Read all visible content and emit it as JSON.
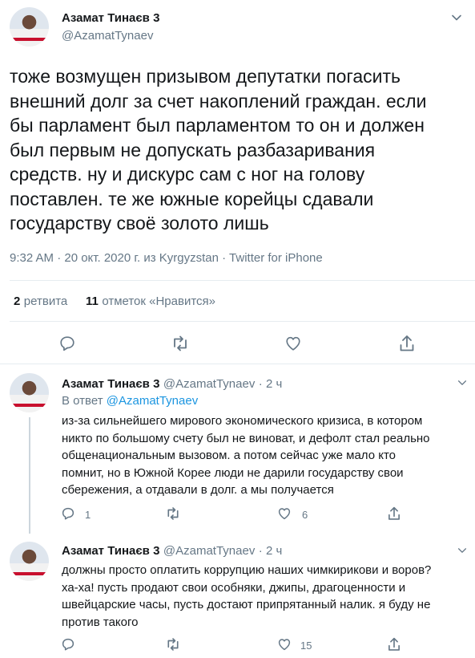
{
  "main_tweet": {
    "author_name": "Азамат Тинаєв 3",
    "author_handle": "@AzamatTynaev",
    "text_lines": [
      "тоже возмущен призывом депутатки погасить",
      "внешний долг за счет накоплений граждан. если",
      "бы парламент был парламентом то он и должен",
      "был первым не допускать разбазаривания",
      "средств. ну и дискурс сам с ног на голову",
      "поставлен. те же южные корейцы сдавали",
      "государству своё золото лишь"
    ],
    "meta": "9:32 AM · 20 окт. 2020 г. из Kyrgyzstan · Twitter for iPhone",
    "retweets_count": "2",
    "retweets_label": "ретвита",
    "likes_count": "11",
    "likes_label": "отметок «Нравится»"
  },
  "replies": [
    {
      "author_name": "Азамат Тинаєв 3",
      "author_handle": "@AzamatTynaev",
      "time": "· 2 ч",
      "reply_to_prefix": "В ответ",
      "reply_to_handle": "@AzamatTynaev",
      "text_lines": [
        "из-за сильнейшего мирового экономического кризиса, в котором",
        "никто по большому счету был не виноват, и дефолт стал реально",
        "общенациональным вызовом. а потом сейчас уже мало кто",
        "помнит, но в Южной Корее люди не дарили государству свои",
        "сбережения, а отдавали в долг. а мы получается"
      ],
      "reply_count": "1",
      "retweet_count": "",
      "like_count": "6"
    },
    {
      "author_name": "Азамат Тинаєв 3",
      "author_handle": "@AzamatTynaev",
      "time": "· 2 ч",
      "text_lines": [
        "должны просто оплатить коррупцию наших чимкирикови и воров?",
        "ха-ха! пусть продают свои особняки, джипы, драгоценности и",
        "швейцарские часы, пусть достают припрятанный налик. я буду не",
        "против такого"
      ],
      "reply_count": "",
      "retweet_count": "",
      "like_count": "15"
    }
  ],
  "icons": {
    "reply": "speech-bubble-icon",
    "retweet": "retweet-arrows-icon",
    "like": "heart-icon",
    "share": "share-arrow-icon",
    "more": "chevron-down-icon"
  },
  "colors": {
    "link": "#1b95e0",
    "muted": "#657786",
    "text": "#14171a",
    "divider": "#e6ecf0"
  }
}
